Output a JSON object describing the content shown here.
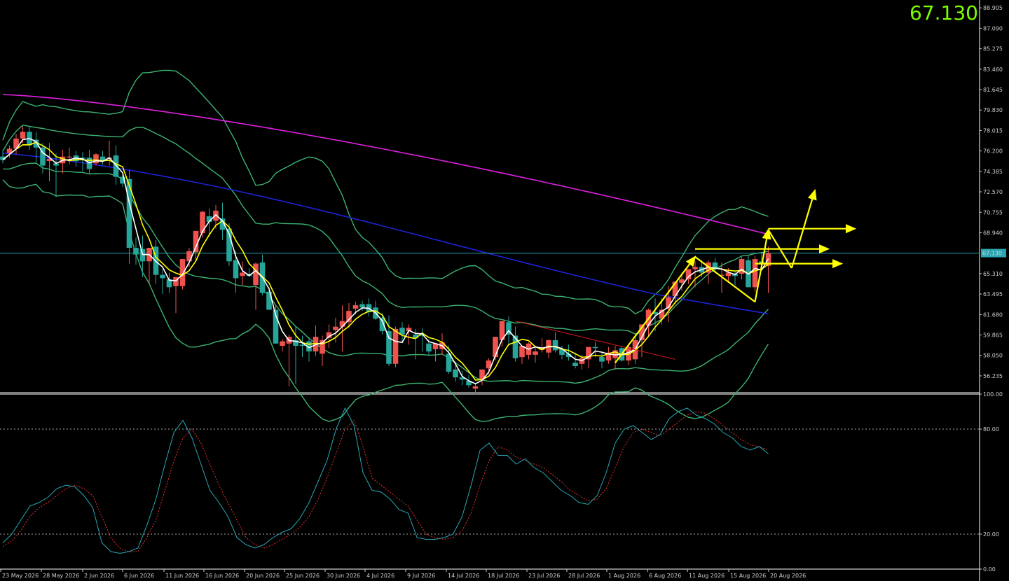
{
  "header": {
    "last_price": "67.130"
  },
  "colors": {
    "background": "#000000",
    "bull": "#ef5350",
    "bear": "#26a69a",
    "boll": "#3cb371",
    "ma_fast": "#ffffff",
    "ma_mid": "#ffff00",
    "ma_100": "#1e22d8",
    "ma_200": "#e020e0",
    "stoch_k": "#2aa7b5",
    "stoch_d": "#e03030",
    "annotation": "#ffff00",
    "trendline": "#d01818",
    "current_line": "#2aa7b5",
    "price_tag": "#2aa7b5"
  },
  "chart_data": [
    {
      "type": "candlestick",
      "title": "",
      "ylim": [
        54.8,
        89.6
      ],
      "y_ticks": [
        "88.905",
        "87.090",
        "85.275",
        "83.460",
        "81.645",
        "79.830",
        "78.015",
        "76.200",
        "74.385",
        "72.570",
        "70.755",
        "68.940",
        "67.130",
        "65.310",
        "63.495",
        "61.680",
        "59.865",
        "58.050",
        "56.235"
      ],
      "x_ticks": [
        "23 May 2026",
        "28 May 2026",
        "2 Jun 2026",
        "6 Jun 2026",
        "11 Jun 2026",
        "16 Jun 2026",
        "20 Jun 2026",
        "25 Jun 2026",
        "30 Jun 2026",
        "4 Jul 2026",
        "9 Jul 2026",
        "14 Jul 2026",
        "18 Jul 2026",
        "23 Jul 2026",
        "28 Jul 2026",
        "1 Aug 2026",
        "6 Aug 2026",
        "11 Aug 2026",
        "15 Aug 2026",
        "20 Aug 2026"
      ],
      "current_price": 67.13,
      "ohlc": [
        [
          75.7,
          76.3,
          75.1,
          75.4
        ],
        [
          76.0,
          76.7,
          75.6,
          76.4
        ],
        [
          76.4,
          77.7,
          75.9,
          77.3
        ],
        [
          77.3,
          78.4,
          76.9,
          77.9
        ],
        [
          77.9,
          78.4,
          76.3,
          76.7
        ],
        [
          77.2,
          77.9,
          75.2,
          76.5
        ],
        [
          76.5,
          76.9,
          74.2,
          74.9
        ],
        [
          75.3,
          76.9,
          73.5,
          75.5
        ],
        [
          75.1,
          76.0,
          72.1,
          74.9
        ],
        [
          75.1,
          76.3,
          74.2,
          75.7
        ],
        [
          75.7,
          76.5,
          75.0,
          75.7
        ],
        [
          75.8,
          76.2,
          74.8,
          75.3
        ],
        [
          75.6,
          76.1,
          74.4,
          75.5
        ],
        [
          75.6,
          76.3,
          74.2,
          74.6
        ],
        [
          75.1,
          76.0,
          74.9,
          75.9
        ],
        [
          75.7,
          76.2,
          75.0,
          75.3
        ],
        [
          75.5,
          77.1,
          74.9,
          75.6
        ],
        [
          75.8,
          76.7,
          73.2,
          73.9
        ],
        [
          73.9,
          74.3,
          73.0,
          73.3
        ],
        [
          73.7,
          74.5,
          66.2,
          67.6
        ],
        [
          67.6,
          68.5,
          66.1,
          67.0
        ],
        [
          67.5,
          68.7,
          65.0,
          66.4
        ],
        [
          66.4,
          67.5,
          64.4,
          67.6
        ],
        [
          67.7,
          68.3,
          64.4,
          65.2
        ],
        [
          65.2,
          65.7,
          63.5,
          64.9
        ],
        [
          64.8,
          65.4,
          63.6,
          64.1
        ],
        [
          64.2,
          64.7,
          61.8,
          65.0
        ],
        [
          64.2,
          66.3,
          63.9,
          66.6
        ],
        [
          66.4,
          67.6,
          65.9,
          67.3
        ],
        [
          67.2,
          68.0,
          66.5,
          69.1
        ],
        [
          68.9,
          70.9,
          68.5,
          70.8
        ],
        [
          70.4,
          71.1,
          68.6,
          69.9
        ],
        [
          70.0,
          71.4,
          69.3,
          70.9
        ],
        [
          70.2,
          71.6,
          68.3,
          69.2
        ],
        [
          69.3,
          69.8,
          66.0,
          66.4
        ],
        [
          66.5,
          67.3,
          63.6,
          64.9
        ],
        [
          65.1,
          66.4,
          64.3,
          65.4
        ],
        [
          65.3,
          65.8,
          65.0,
          65.1
        ],
        [
          64.3,
          66.3,
          62.1,
          66.2
        ],
        [
          66.3,
          67.0,
          63.4,
          63.6
        ],
        [
          63.7,
          64.1,
          62.6,
          62.1
        ],
        [
          62.1,
          62.5,
          59.1,
          59.1
        ],
        [
          58.9,
          59.5,
          58.4,
          59.3
        ],
        [
          59.1,
          59.9,
          55.3,
          59.7
        ],
        [
          59.4,
          60.6,
          55.5,
          58.9
        ],
        [
          59.0,
          59.8,
          57.9,
          58.9
        ],
        [
          59.3,
          59.7,
          57.5,
          58.4
        ],
        [
          58.4,
          60.7,
          58.0,
          59.7
        ],
        [
          58.2,
          59.8,
          57.1,
          59.4
        ],
        [
          59.6,
          60.8,
          58.7,
          60.1
        ],
        [
          60.3,
          61.4,
          59.2,
          60.6
        ],
        [
          60.6,
          62.5,
          58.4,
          61.1
        ],
        [
          61.0,
          62.7,
          60.5,
          62.0
        ],
        [
          62.2,
          62.8,
          61.7,
          62.5
        ],
        [
          62.6,
          62.9,
          62.0,
          62.3
        ],
        [
          62.6,
          63.1,
          61.5,
          61.9
        ],
        [
          62.3,
          62.9,
          61.2,
          61.3
        ],
        [
          61.4,
          61.8,
          59.9,
          60.2
        ],
        [
          60.2,
          61.6,
          57.1,
          57.3
        ],
        [
          57.3,
          60.6,
          57.0,
          60.4
        ],
        [
          60.5,
          61.0,
          59.2,
          59.9
        ],
        [
          60.2,
          60.8,
          59.0,
          60.5
        ],
        [
          59.9,
          60.4,
          57.7,
          59.6
        ],
        [
          59.9,
          60.5,
          58.4,
          59.8
        ],
        [
          59.1,
          59.5,
          58.0,
          58.4
        ],
        [
          58.6,
          59.0,
          57.5,
          59.1
        ],
        [
          58.6,
          60.0,
          58.1,
          59.2
        ],
        [
          58.2,
          58.9,
          56.4,
          56.6
        ],
        [
          56.8,
          57.5,
          55.7,
          56.1
        ],
        [
          56.1,
          56.7,
          55.4,
          55.9
        ],
        [
          55.8,
          56.3,
          55.2,
          55.4
        ],
        [
          55.1,
          55.6,
          54.7,
          55.3
        ],
        [
          55.9,
          56.7,
          55.4,
          56.8
        ],
        [
          56.9,
          57.8,
          56.4,
          57.6
        ],
        [
          57.9,
          59.6,
          57.6,
          59.7
        ],
        [
          59.4,
          60.8,
          58.8,
          61.1
        ],
        [
          61.0,
          61.5,
          58.9,
          59.9
        ],
        [
          59.8,
          60.6,
          57.5,
          57.8
        ],
        [
          57.9,
          58.8,
          57.3,
          58.9
        ],
        [
          58.1,
          59.2,
          57.7,
          59.1
        ],
        [
          58.1,
          58.8,
          57.4,
          58.4
        ],
        [
          58.6,
          59.6,
          58.3,
          58.6
        ],
        [
          58.3,
          59.5,
          57.8,
          59.4
        ],
        [
          59.4,
          60.1,
          58.3,
          58.5
        ],
        [
          58.6,
          58.9,
          57.7,
          58.1
        ],
        [
          58.2,
          59.0,
          57.6,
          57.9
        ],
        [
          57.4,
          58.3,
          56.9,
          57.1
        ],
        [
          57.3,
          58.1,
          56.8,
          57.8
        ],
        [
          57.7,
          58.6,
          56.9,
          58.8
        ],
        [
          58.8,
          59.3,
          57.9,
          58.7
        ],
        [
          57.9,
          58.4,
          56.9,
          57.5
        ],
        [
          57.6,
          58.8,
          57.3,
          58.3
        ],
        [
          57.8,
          58.9,
          56.8,
          58.5
        ],
        [
          58.7,
          58.9,
          57.5,
          57.6
        ],
        [
          57.6,
          58.9,
          57.2,
          58.8
        ],
        [
          57.7,
          59.7,
          57.3,
          59.4
        ],
        [
          59.4,
          60.4,
          57.9,
          60.8
        ],
        [
          60.7,
          62.2,
          59.8,
          62.1
        ],
        [
          61.9,
          63.1,
          60.2,
          61.7
        ],
        [
          61.3,
          63.1,
          60.8,
          62.1
        ],
        [
          62.2,
          64.2,
          61.0,
          63.2
        ],
        [
          63.3,
          64.5,
          62.6,
          64.6
        ],
        [
          64.5,
          65.4,
          63.8,
          64.8
        ],
        [
          64.8,
          65.6,
          64.4,
          65.7
        ],
        [
          65.7,
          66.4,
          64.1,
          65.9
        ],
        [
          65.9,
          66.5,
          65.0,
          65.4
        ],
        [
          65.4,
          66.5,
          64.4,
          66.3
        ],
        [
          66.3,
          66.7,
          65.4,
          65.7
        ],
        [
          65.2,
          66.3,
          63.6,
          65.2
        ],
        [
          65.1,
          65.8,
          64.5,
          65.4
        ],
        [
          65.3,
          65.5,
          64.3,
          65.1
        ],
        [
          65.3,
          66.8,
          64.8,
          66.6
        ],
        [
          66.5,
          66.9,
          64.8,
          64.1
        ],
        [
          64.1,
          66.9,
          63.7,
          66.6
        ],
        [
          66.4,
          67.1,
          65.7,
          66.2
        ],
        [
          66.0,
          67.7,
          63.6,
          67.1
        ]
      ]
    },
    {
      "type": "line",
      "title": "",
      "ylim": [
        0,
        100
      ],
      "y_ticks": [
        "100.00",
        "80.00",
        "20.00",
        "0.00"
      ],
      "levels": [
        80,
        20
      ],
      "series": [
        {
          "values": [
            15,
            20,
            28,
            36,
            38,
            41,
            46,
            48,
            47,
            42,
            35,
            15,
            10,
            9,
            10,
            12,
            25,
            40,
            60,
            78,
            85,
            75,
            60,
            45,
            38,
            30,
            18,
            14,
            12,
            14,
            18,
            21,
            23,
            29,
            38,
            50,
            62,
            80,
            92,
            82,
            55,
            45,
            44,
            40,
            34,
            32,
            18,
            17,
            17,
            18,
            20,
            30,
            48,
            68,
            72,
            65,
            65,
            60,
            63,
            58,
            55,
            50,
            45,
            42,
            38,
            37,
            42,
            55,
            72,
            80,
            82,
            78,
            74,
            77,
            86,
            90,
            92,
            88,
            86,
            83,
            78,
            75,
            70,
            68,
            70,
            66
          ]
        },
        {
          "values": [
            13,
            16,
            22,
            30,
            35,
            38,
            42,
            46,
            48,
            46,
            42,
            30,
            18,
            12,
            10,
            10,
            18,
            28,
            45,
            62,
            75,
            80,
            72,
            60,
            48,
            38,
            28,
            18,
            14,
            12,
            14,
            17,
            20,
            24,
            30,
            40,
            52,
            66,
            80,
            85,
            70,
            52,
            48,
            44,
            40,
            36,
            28,
            20,
            18,
            17,
            18,
            22,
            32,
            48,
            62,
            70,
            68,
            64,
            62,
            60,
            58,
            54,
            50,
            45,
            42,
            39,
            40,
            46,
            58,
            70,
            78,
            80,
            78,
            76,
            80,
            84,
            88,
            90,
            89,
            86,
            82,
            78,
            74,
            71,
            70,
            68
          ]
        }
      ]
    }
  ]
}
